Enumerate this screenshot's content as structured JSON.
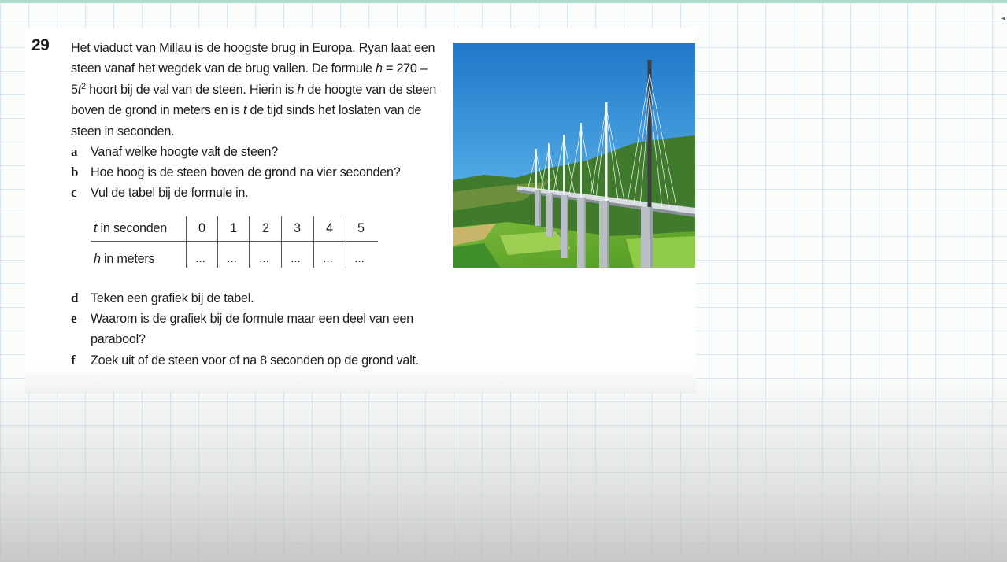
{
  "exercise": {
    "number": "29",
    "intro": {
      "p1": "Het viaduct van Millau is de hoogste brug in Europa. Ryan laat een steen vanaf het wegdek van de brug vallen. De formule ",
      "var_h": "h",
      "eq": " = 270 – 5",
      "var_t": "t",
      "exp": "2",
      "p2": " hoort bij de val van de steen. Hierin is ",
      "var_h2": "h",
      "p3": " de hoogte van de steen boven de grond in meters en is ",
      "var_t2": "t",
      "p4": " de tijd sinds het loslaten van de steen in seconden."
    },
    "questions": [
      {
        "letter": "a",
        "text": "Vanaf welke hoogte valt de steen?"
      },
      {
        "letter": "b",
        "text": "Hoe hoog is de steen boven de grond na vier seconden?"
      },
      {
        "letter": "c",
        "text": "Vul de tabel bij de formule in."
      },
      {
        "letter": "d",
        "text": "Teken een grafiek bij de tabel."
      },
      {
        "letter": "e",
        "text": "Waarom is de grafiek bij de formule maar een deel van een parabool?"
      },
      {
        "letter": "f",
        "text": "Zoek uit of de steen voor of na 8 seconden op de grond valt."
      }
    ],
    "table": {
      "row1_var": "t",
      "row1_label": " in seconden",
      "row2_var": "h",
      "row2_label": " in meters",
      "t_values": [
        "0",
        "1",
        "2",
        "3",
        "4",
        "5"
      ],
      "h_values": [
        "...",
        "...",
        "...",
        "...",
        "...",
        "..."
      ]
    }
  },
  "photo": {
    "subject": "Viaduct van Millau bridge photo"
  },
  "colors": {
    "top_bar": "#a7dccd",
    "grid": "#96bedc",
    "paper": "#ffffff"
  }
}
